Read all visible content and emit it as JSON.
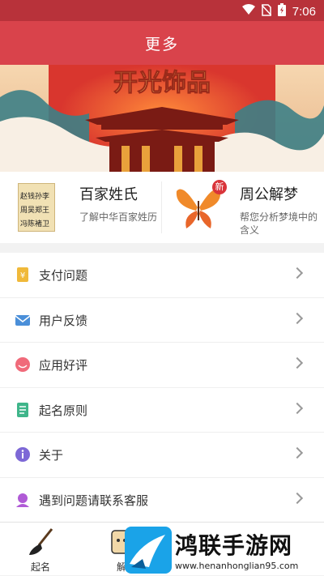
{
  "status": {
    "time": "7:06",
    "icons": [
      "wifi-icon",
      "no-sim-icon",
      "battery-charging-icon"
    ]
  },
  "header": {
    "title": "更多"
  },
  "banner": {
    "headline": "开光饰品"
  },
  "features": [
    {
      "title": "百家姓氏",
      "desc": "了解中华百家姓历",
      "thumb": [
        "赵钱孙李",
        "周吴郑王",
        "冯陈褚卫"
      ]
    },
    {
      "title": "周公解梦",
      "desc": "帮您分析梦境中的含义",
      "badge": "新"
    }
  ],
  "menu": [
    {
      "label": "支付问题",
      "icon": "payment-icon",
      "color": "#f0b93a"
    },
    {
      "label": "用户反馈",
      "icon": "mail-icon",
      "color": "#4a8fd9"
    },
    {
      "label": "应用好评",
      "icon": "smile-icon",
      "color": "#f06a7a"
    },
    {
      "label": "起名原则",
      "icon": "document-icon",
      "color": "#3fb58a"
    },
    {
      "label": "关于",
      "icon": "info-icon",
      "color": "#7d68d6"
    },
    {
      "label": "遇到问题请联系客服",
      "icon": "customer-service-icon",
      "color": "#b05ad6"
    }
  ],
  "tabbar": [
    {
      "label": "起名",
      "icon": "brush-icon"
    },
    {
      "label": "解",
      "icon": "dream-icon"
    }
  ],
  "watermark": {
    "title": "鸿联手游网",
    "url": "www.henanhonglian95.com"
  },
  "colors": {
    "header": "#d9434b",
    "status": "#b8323a"
  }
}
